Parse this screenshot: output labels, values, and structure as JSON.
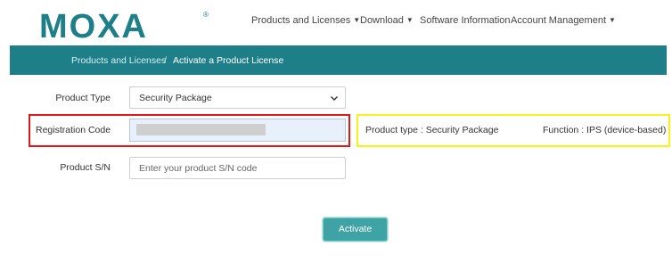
{
  "header": {
    "logo_text": "MOXA",
    "nav": [
      {
        "label": "Products and Licenses",
        "has_dropdown": true
      },
      {
        "label": "Download",
        "has_dropdown": true
      },
      {
        "label": "Software Information",
        "has_dropdown": false
      },
      {
        "label": "Account Management",
        "has_dropdown": true
      }
    ]
  },
  "breadcrumb": {
    "parent": "Products and Licenses",
    "separator": "/",
    "current": "Activate a Product License"
  },
  "form": {
    "product_type": {
      "label": "Product Type",
      "value": "Security Package"
    },
    "registration_code": {
      "label": "Registration Code",
      "value": "",
      "masked": true
    },
    "product_sn": {
      "label": "Product S/N",
      "placeholder": "Enter your product S/N code",
      "value": ""
    }
  },
  "info": {
    "product_type_text": "Product type : Security Package",
    "function_text": "Function : IPS (device-based)"
  },
  "actions": {
    "activate_label": "Activate"
  },
  "colors": {
    "brand_teal": "#1f7f88",
    "button_teal": "#3fa3a6",
    "highlight_red": "#e01818",
    "highlight_yellow": "#f7f21a"
  },
  "icons": {
    "nav_dropdown": "caret-down-icon",
    "select_chevron": "chevron-down-icon"
  }
}
